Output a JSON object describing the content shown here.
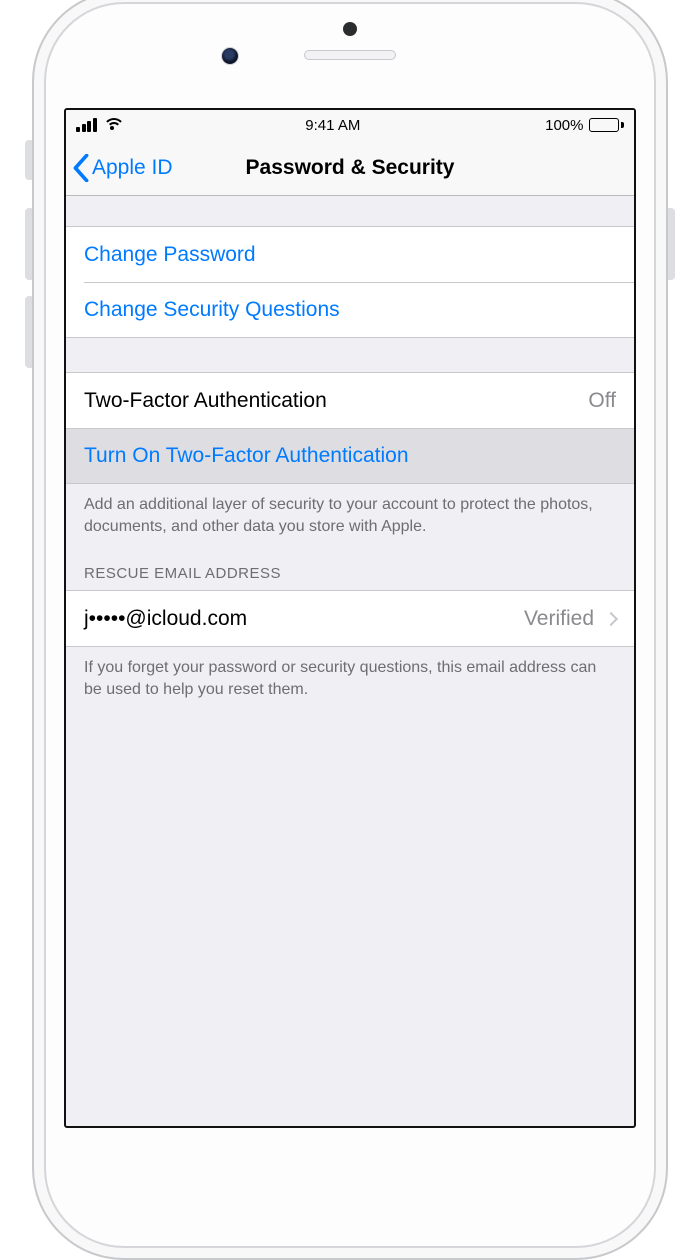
{
  "status": {
    "time": "9:41 AM",
    "battery_pct": "100%"
  },
  "nav": {
    "back_label": "Apple ID",
    "title": "Password & Security"
  },
  "group1": {
    "change_password": "Change Password",
    "change_questions": "Change Security Questions"
  },
  "group2": {
    "twofa_label": "Two-Factor Authentication",
    "twofa_value": "Off",
    "turn_on_label": "Turn On Two-Factor Authentication",
    "footer": "Add an additional layer of security to your account to protect the photos, documents, and other data you store with Apple."
  },
  "group3": {
    "header": "RESCUE EMAIL ADDRESS",
    "email": "j•••••@icloud.com",
    "status": "Verified",
    "footer": "If you forget your password or security questions, this email address can be used to help you reset them."
  }
}
